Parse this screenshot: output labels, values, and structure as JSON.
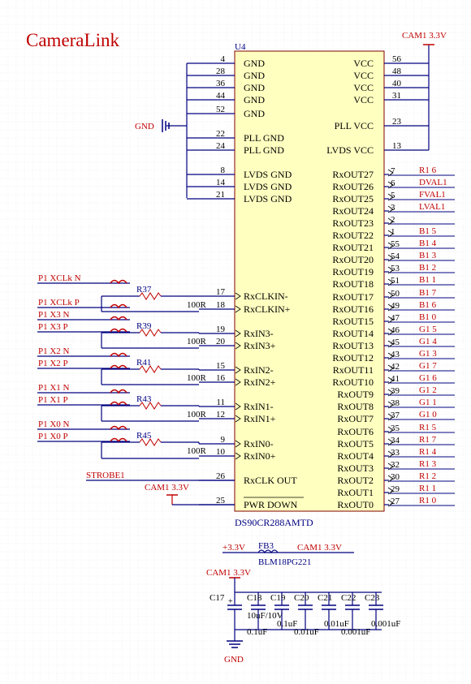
{
  "title": "CameraLink",
  "chip": {
    "ref": "U4",
    "part": "DS90CR288AMTD",
    "left_pins": [
      {
        "num": "4",
        "name": "GND"
      },
      {
        "num": "28",
        "name": "GND"
      },
      {
        "num": "36",
        "name": "GND"
      },
      {
        "num": "44",
        "name": "GND"
      },
      {
        "num": "52",
        "name": "GND"
      },
      {
        "num": "22",
        "name": "PLL GND"
      },
      {
        "num": "24",
        "name": "PLL GND"
      },
      {
        "num": "8",
        "name": "LVDS GND"
      },
      {
        "num": "14",
        "name": "LVDS GND"
      },
      {
        "num": "21",
        "name": "LVDS GND"
      },
      {
        "num": "17",
        "name": "RxCLKIN-"
      },
      {
        "num": "18",
        "name": "RxCLKIN+"
      },
      {
        "num": "19",
        "name": "RxIN3-"
      },
      {
        "num": "20",
        "name": "RxIN3+"
      },
      {
        "num": "15",
        "name": "RxIN2-"
      },
      {
        "num": "16",
        "name": "RxIN2+"
      },
      {
        "num": "11",
        "name": "RxIN1-"
      },
      {
        "num": "12",
        "name": "RxIN1+"
      },
      {
        "num": "9",
        "name": "RxIN0-"
      },
      {
        "num": "10",
        "name": "RxIN0+"
      },
      {
        "num": "26",
        "name": "RxCLK OUT"
      },
      {
        "num": "25",
        "name": "PWR DOWN"
      }
    ],
    "right_pins": [
      {
        "num": "56",
        "name": "VCC",
        "net": ""
      },
      {
        "num": "48",
        "name": "VCC",
        "net": ""
      },
      {
        "num": "40",
        "name": "VCC",
        "net": ""
      },
      {
        "num": "31",
        "name": "VCC",
        "net": ""
      },
      {
        "num": "23",
        "name": "PLL VCC",
        "net": ""
      },
      {
        "num": "13",
        "name": "LVDS VCC",
        "net": ""
      },
      {
        "num": "7",
        "name": "RxOUT27",
        "net": "R1 6"
      },
      {
        "num": "6",
        "name": "RxOUT26",
        "net": "DVAL1"
      },
      {
        "num": "5",
        "name": "RxOUT25",
        "net": "FVAL1"
      },
      {
        "num": "3",
        "name": "RxOUT24",
        "net": "LVAL1"
      },
      {
        "num": "2",
        "name": "RxOUT23",
        "net": ""
      },
      {
        "num": "1",
        "name": "RxOUT22",
        "net": "B1 5"
      },
      {
        "num": "55",
        "name": "RxOUT21",
        "net": "B1 4"
      },
      {
        "num": "54",
        "name": "RxOUT20",
        "net": "B1 3"
      },
      {
        "num": "53",
        "name": "RxOUT19",
        "net": "B1 2"
      },
      {
        "num": "51",
        "name": "RxOUT18",
        "net": "B1 1"
      },
      {
        "num": "50",
        "name": "RxOUT17",
        "net": "B1 7"
      },
      {
        "num": "49",
        "name": "RxOUT16",
        "net": "B1 6"
      },
      {
        "num": "47",
        "name": "RxOUT15",
        "net": "B1 0"
      },
      {
        "num": "46",
        "name": "RxOUT14",
        "net": "G1 5"
      },
      {
        "num": "45",
        "name": "RxOUT13",
        "net": "G1 4"
      },
      {
        "num": "43",
        "name": "RxOUT12",
        "net": "G1 3"
      },
      {
        "num": "42",
        "name": "RxOUT11",
        "net": "G1 7"
      },
      {
        "num": "41",
        "name": "RxOUT10",
        "net": "G1 6"
      },
      {
        "num": "39",
        "name": "RxOUT9",
        "net": "G1 2"
      },
      {
        "num": "38",
        "name": "RxOUT8",
        "net": "G1 1"
      },
      {
        "num": "37",
        "name": "RxOUT7",
        "net": "G1 0"
      },
      {
        "num": "35",
        "name": "RxOUT6",
        "net": "R1 5"
      },
      {
        "num": "34",
        "name": "RxOUT5",
        "net": "R1 7"
      },
      {
        "num": "33",
        "name": "RxOUT4",
        "net": "R1 4"
      },
      {
        "num": "32",
        "name": "RxOUT3",
        "net": "R1 3"
      },
      {
        "num": "30",
        "name": "RxOUT2",
        "net": "R1 2"
      },
      {
        "num": "29",
        "name": "RxOUT1",
        "net": "R1 1"
      },
      {
        "num": "27",
        "name": "RxOUT0",
        "net": "R1 0"
      }
    ]
  },
  "input_nets": [
    {
      "name": "P1 XCLk N"
    },
    {
      "name": "P1 XCLk P"
    },
    {
      "name": "P1 X3 N"
    },
    {
      "name": "P1 X3 P"
    },
    {
      "name": "P1 X2 N"
    },
    {
      "name": "P1 X2 P"
    },
    {
      "name": "P1 X1 N"
    },
    {
      "name": "P1 X1 P"
    },
    {
      "name": "P1 X0 N"
    },
    {
      "name": "P1 X0 P"
    }
  ],
  "resistors": [
    {
      "ref": "R37",
      "value": "100R"
    },
    {
      "ref": "R39",
      "value": "100R"
    },
    {
      "ref": "R41",
      "value": "100R"
    },
    {
      "ref": "R43",
      "value": "100R"
    },
    {
      "ref": "R45",
      "value": "100R"
    }
  ],
  "labels": {
    "cam_power_top": "CAM1 3.3V",
    "gnd": "GND",
    "strobe": "STROBE1",
    "cam_power_pwrdown": "CAM1 3.3V",
    "cam_power_caps": "CAM1 3.3V",
    "gnd_bottom": "GND"
  },
  "ferrite": {
    "ref": "FB3",
    "part": "BLM18PG221",
    "in_net": "+3.3V",
    "out_net": "CAM1 3.3V"
  },
  "capacitors": [
    {
      "ref": "C17",
      "value": "10uF/10V"
    },
    {
      "ref": "C18",
      "value": "0.1uF"
    },
    {
      "ref": "C19",
      "value": "0.1uF"
    },
    {
      "ref": "C20",
      "value": "0.01uF"
    },
    {
      "ref": "C21",
      "value": "0.01uF"
    },
    {
      "ref": "C22",
      "value": "0.001uF"
    },
    {
      "ref": "C23",
      "value": "0.001uF"
    }
  ],
  "colors": {
    "wire": "#000080",
    "label": "#c00000",
    "body_fill": "#ffffc0",
    "body_stroke": "#800000",
    "text": "#000000",
    "grid": "#e4e4e4"
  }
}
